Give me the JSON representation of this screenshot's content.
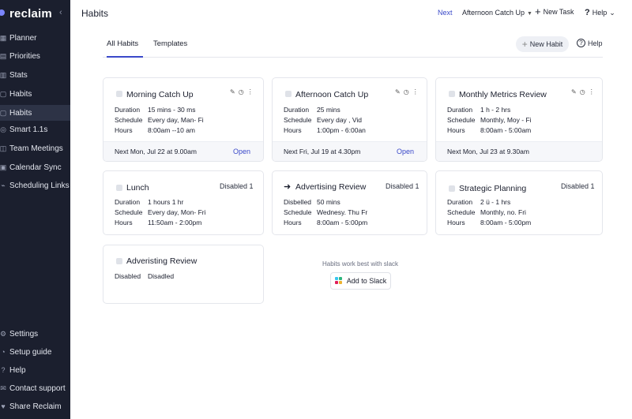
{
  "sidebar": {
    "brand": "reclaim",
    "collapse_icon": "‹",
    "items": [
      {
        "label": "Planner",
        "icon": "▦"
      },
      {
        "label": "Priorities",
        "icon": "▤"
      },
      {
        "label": "Stats",
        "icon": "▥"
      },
      {
        "label": "Habits",
        "icon": "▢"
      },
      {
        "label": "Habits",
        "icon": "▢"
      },
      {
        "label": "Smart 1.1s",
        "icon": "◎"
      },
      {
        "label": "Team Meetings",
        "icon": "◫"
      },
      {
        "label": "Calendar Sync",
        "icon": "▣"
      },
      {
        "label": "Scheduling Links",
        "icon": "⌁"
      }
    ],
    "bottom_items": [
      {
        "label": "Settings",
        "icon": "⚙"
      },
      {
        "label": "Setup guide",
        "icon": "◔"
      },
      {
        "label": "Help",
        "icon": "?"
      },
      {
        "label": "Contact support",
        "icon": "✉"
      },
      {
        "label": "Share Reclaim",
        "icon": "♥"
      }
    ]
  },
  "header": {
    "title": "Habits",
    "next_label": "Next",
    "next_task": "Afternoon Catch Up",
    "new_task": "New Task",
    "help": "Help"
  },
  "tabs": [
    {
      "label": "All Habits"
    },
    {
      "label": "Templates"
    }
  ],
  "actions": {
    "new_habit": "New Habit",
    "help": "Help"
  },
  "cards": [
    {
      "title": "Morning Catch Up",
      "rows": [
        {
          "k": "Duration",
          "v": "15 mins - 30 ms"
        },
        {
          "k": "Schedule",
          "v": "Every day, Man- Fi"
        },
        {
          "k": "Hours",
          "v": "8:00am --10 am"
        }
      ],
      "next": "Next Mon, Jul 22 at 9.00am",
      "open": "Open"
    },
    {
      "title": "Afternoon Catch Up",
      "rows": [
        {
          "k": "Duration",
          "v": "25 mins"
        },
        {
          "k": "Schedule",
          "v": "Every day , Vid"
        },
        {
          "k": "Hours",
          "v": "1:00pm - 6:00an"
        }
      ],
      "next": "Next Fri, Jul 19 at 4.30pm",
      "open": "Open"
    },
    {
      "title": "Monthly Metrics Review",
      "rows": [
        {
          "k": "Duration",
          "v": "1 h - 2 hrs"
        },
        {
          "k": "Schedule",
          "v": "Monthly, Moy - Fi"
        },
        {
          "k": "Hours",
          "v": "8:00am - 5:00am"
        }
      ],
      "next": "Next Mon, Jul 23 at 9.30am"
    },
    {
      "title": "Lunch",
      "status": "Disabled  1",
      "rows": [
        {
          "k": "Duration",
          "v": "1 hours   1 hr"
        },
        {
          "k": "Schedule",
          "v": "Every day, Mon- Fri"
        },
        {
          "k": "Hours",
          "v": "11:50am - 2:00pm"
        }
      ]
    },
    {
      "title": "Advertising Review",
      "status": "Disabled  1",
      "rows": [
        {
          "k": "Disbelled",
          "v": "50 mins"
        },
        {
          "k": "Schedule",
          "v": "Wednesy. Thu  Fr"
        },
        {
          "k": "Hours",
          "v": "8:00am - 5:00pm"
        }
      ]
    },
    {
      "title": "Strategic Planning",
      "status": "Disabled  1",
      "rows": [
        {
          "k": "Duration",
          "v": "2 ü - 1 hrs"
        },
        {
          "k": "Schedule",
          "v": "Monthly, no. Fri"
        },
        {
          "k": "Hours",
          "v": "8:00am - 5:00pm"
        }
      ]
    },
    {
      "title": "Adveristing Review",
      "rows": [
        {
          "k": "Disabled",
          "v": "Disadled"
        }
      ]
    }
  ],
  "slack": {
    "hint": "Habits work best with slack",
    "button": "Add to Slack"
  },
  "colors": {
    "sidebar_bg": "#1b1f2e",
    "accent": "#3a49c9",
    "card_border": "#e4e6ec"
  }
}
